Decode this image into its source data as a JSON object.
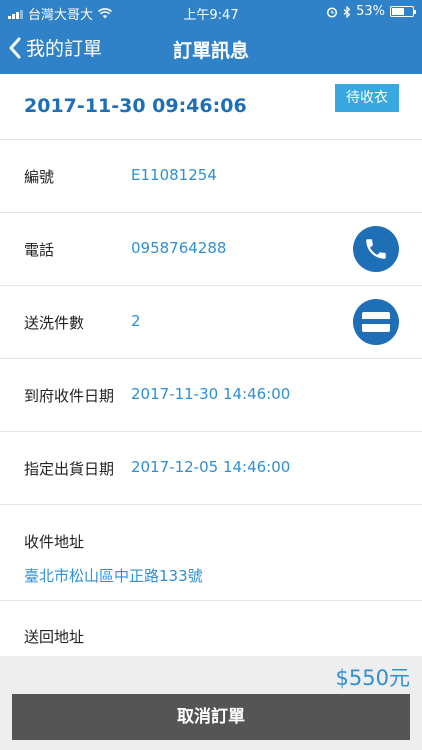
{
  "status_bar": {
    "carrier": "台灣大哥大",
    "time": "上午9:47",
    "battery_text": "53%",
    "battery_level": 0.53
  },
  "nav": {
    "back_label": "我的訂單",
    "title": "訂單訊息"
  },
  "order": {
    "datetime": "2017-11-30 09:46:06",
    "status_badge": "待收衣",
    "fields": [
      {
        "label": "編號",
        "value": "E11081254"
      },
      {
        "label": "電話",
        "value": "0958764288",
        "action_icon": "phone-icon"
      },
      {
        "label": "送洗件數",
        "value": "2",
        "action_icon": "card-icon"
      },
      {
        "label": "到府收件日期",
        "value": "2017-11-30 14:46:00"
      },
      {
        "label": "指定出貨日期",
        "value": "2017-12-05 14:46:00"
      }
    ],
    "pickup_address_label": "收件地址",
    "pickup_address": "臺北市松山區中正路133號",
    "return_address_label": "送回地址"
  },
  "footer": {
    "price": "$550元",
    "cancel_label": "取消訂單"
  },
  "colors": {
    "header": "#2f82c8",
    "accent": "#2f8fd4",
    "badge": "#39a7e0",
    "button": "#555555"
  }
}
